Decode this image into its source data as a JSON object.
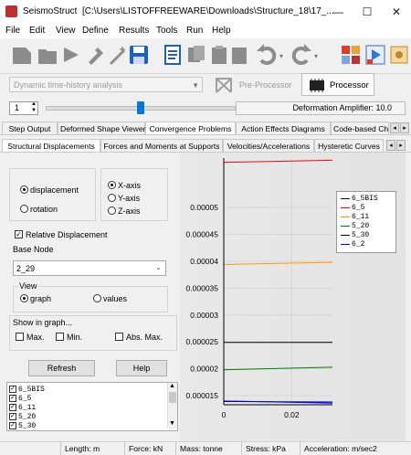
{
  "window": {
    "app_name": "SeismoStruct",
    "path": "[C:\\Users\\LISTOFFREEWARE\\Downloads\\Structure_18\\17_...",
    "minimize": "—",
    "maximize": "☐",
    "close": "✕"
  },
  "menu": [
    "File",
    "Edit",
    "View",
    "Define",
    "Results",
    "Tools",
    "Run",
    "Help"
  ],
  "toolbar": {
    "analysis_type": "Dynamic time-history analysis",
    "preprocessor_label": "Pre-Processor",
    "processor_label": "Processor",
    "step_value": "1",
    "deformation_label": "Deformation Amplifier: 10.0"
  },
  "main_tabs": [
    "Step Output",
    "Deformed Shape Viewer",
    "Convergence Problems",
    "Action Effects Diagrams",
    "Code-based Ch"
  ],
  "sub_tabs": [
    "Structural Displacements",
    "Forces and Moments at Supports",
    "Velocities/Accelerations",
    "Hysteretic Curves"
  ],
  "options": {
    "displacement": "displacement",
    "rotation": "rotation",
    "x_axis": "X-axis",
    "y_axis": "Y-axis",
    "z_axis": "Z-axis",
    "relative_displacement": "Relative Displacement",
    "base_node_label": "Base Node",
    "base_node_value": "2_29",
    "view_label": "View",
    "graph": "graph",
    "values": "values",
    "show_in_graph_label": "Show in graph...",
    "max": "Max.",
    "min": "Min.",
    "abs_max": "Abs. Max.",
    "refresh": "Refresh",
    "help": "Help"
  },
  "node_list": [
    "6_5BIS",
    "6_5",
    "6_11",
    "5_20",
    "5_30"
  ],
  "statusbar": {
    "length": "Length: m",
    "force": "Force: kN",
    "mass": "Mass: tonne",
    "stress": "Stress: kPa",
    "acceleration": "Acceleration: m/sec2"
  },
  "chart_data": {
    "type": "line",
    "x_ticks": [
      "0",
      "0.02"
    ],
    "y_ticks": [
      "0.00005",
      "0.000045",
      "0.00004",
      "0.000035",
      "0.00003",
      "0.000025",
      "0.00002",
      "0.000015"
    ],
    "xlim": [
      0,
      0.032
    ],
    "ylim": [
      1.33e-05,
      5.92e-05
    ],
    "grid": true,
    "legend_position": "top-right",
    "series": [
      {
        "name": "6_5BIS",
        "color": "#000080",
        "x": [
          0,
          0.032
        ],
        "y": [
          1.39e-05,
          1.38e-05
        ]
      },
      {
        "name": "6_5",
        "color": "#ff0000",
        "x": [
          0,
          0.032
        ],
        "y": [
          5.84e-05,
          5.88e-05
        ]
      },
      {
        "name": "6_11",
        "color": "#ff9900",
        "x": [
          0,
          0.032
        ],
        "y": [
          3.94e-05,
          3.98e-05
        ]
      },
      {
        "name": "5_20",
        "color": "#008000",
        "x": [
          0,
          0.032
        ],
        "y": [
          1.98e-05,
          2.03e-05
        ]
      },
      {
        "name": "5_30",
        "color": "#000000",
        "x": [
          0,
          0.032
        ],
        "y": [
          2.49e-05,
          2.49e-05
        ]
      },
      {
        "name": "6_2",
        "color": "#0000ff",
        "x": [
          0,
          0.032
        ],
        "y": [
          1.4e-05,
          1.36e-05
        ]
      }
    ]
  }
}
